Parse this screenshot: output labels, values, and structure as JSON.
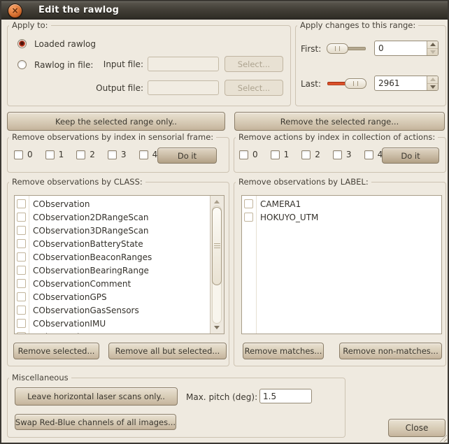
{
  "window": {
    "title": "Edit the rawlog",
    "close_glyph": "×"
  },
  "apply_to": {
    "legend": "Apply to:",
    "radio_loaded": "Loaded rawlog",
    "radio_file": "Rawlog in file:",
    "input_file_label": "Input file:",
    "input_file_value": "",
    "output_file_label": "Output file:",
    "output_file_value": "",
    "select_input_label": "Select...",
    "select_output_label": "Select..."
  },
  "range": {
    "legend": "Apply changes to this range:",
    "first_label": "First:",
    "first_value": "0",
    "last_label": "Last:",
    "last_value": "2961"
  },
  "range_buttons": {
    "keep": "Keep the selected range only..",
    "remove": "Remove the selected range..."
  },
  "sensorial": {
    "legend": "Remove observations by index in sensorial frame:",
    "indices": [
      "0",
      "1",
      "2",
      "3",
      "4"
    ],
    "doit_label": "Do it"
  },
  "actions": {
    "legend": "Remove actions by index in collection of actions:",
    "indices": [
      "0",
      "1",
      "2",
      "3",
      "4"
    ],
    "doit_label": "Do it"
  },
  "by_class": {
    "legend": "Remove observations by CLASS:",
    "items": [
      "CObservation",
      "CObservation2DRangeScan",
      "CObservation3DRangeScan",
      "CObservationBatteryState",
      "CObservationBeaconRanges",
      "CObservationBearingRange",
      "CObservationComment",
      "CObservationGPS",
      "CObservationGasSensors",
      "CObservationIMU",
      "CObservationImage"
    ],
    "remove_selected_label": "Remove selected...",
    "remove_all_but_label": "Remove all but selected..."
  },
  "by_label": {
    "legend": "Remove observations by LABEL:",
    "items": [
      "CAMERA1",
      "HOKUYO_UTM"
    ],
    "remove_matches_label": "Remove matches...",
    "remove_non_matches_label": "Remove non-matches..."
  },
  "misc": {
    "legend": "Miscellaneous",
    "leave_horizontal_label": "Leave horizontal laser scans only..",
    "max_pitch_label": "Max. pitch (deg):",
    "max_pitch_value": "1.5",
    "swap_rb_label": "Swap Red-Blue channels of all images..."
  },
  "close_label": "Close",
  "colors": {
    "background": "#efeae0",
    "titlebar_dark": "#322f28",
    "close_button_orange": "#e07b3a",
    "slider_fill_red": "#ef6237",
    "button_face": "#d9ceb9"
  }
}
